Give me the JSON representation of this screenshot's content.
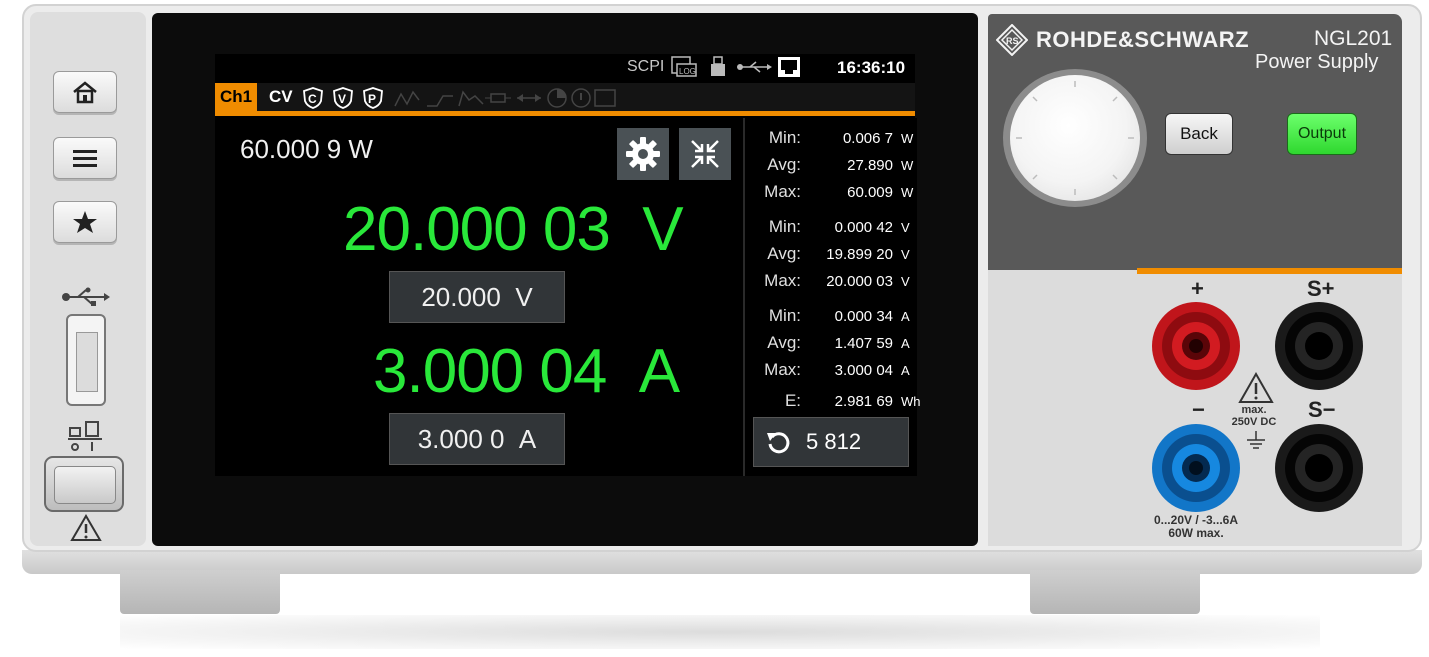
{
  "brand": {
    "name": "ROHDE&SCHWARZ",
    "model": "NGL201",
    "subtitle": "Power Supply"
  },
  "status_bar": {
    "scpi": "SCPI",
    "log_icon": "log-icon",
    "usb_stick_icon": "usb-stick-icon",
    "usb_icon": "usb-icon",
    "lan_icon": "lan-icon",
    "time": "16:36:10"
  },
  "channel_bar": {
    "channel_label": "Ch1",
    "mode": "CV",
    "protections": [
      "C",
      "V",
      "P"
    ],
    "colors": {
      "accent": "#f08c00",
      "value_green": "#29e83a"
    }
  },
  "readings": {
    "power": "60.000 9 W",
    "voltage": {
      "value": "20.000 03",
      "unit": "V",
      "setpoint": "20.000",
      "setpoint_unit": "V"
    },
    "current": {
      "value": "3.000 04",
      "unit": "A",
      "setpoint": "3.000 0",
      "setpoint_unit": "A"
    }
  },
  "stats": {
    "power": [
      {
        "label": "Min:",
        "value": "0.006 7",
        "unit": "W"
      },
      {
        "label": "Avg:",
        "value": "27.890",
        "unit": "W"
      },
      {
        "label": "Max:",
        "value": "60.009",
        "unit": "W"
      }
    ],
    "voltage": [
      {
        "label": "Min:",
        "value": "0.000 42",
        "unit": "V"
      },
      {
        "label": "Avg:",
        "value": "19.899 20",
        "unit": "V"
      },
      {
        "label": "Max:",
        "value": "20.000 03",
        "unit": "V"
      }
    ],
    "current": [
      {
        "label": "Min:",
        "value": "0.000 34",
        "unit": "A"
      },
      {
        "label": "Avg:",
        "value": "1.407 59",
        "unit": "A"
      },
      {
        "label": "Max:",
        "value": "3.000 04",
        "unit": "A"
      }
    ],
    "energy": {
      "label": "E:",
      "value": "2.981 69",
      "unit": "Wh"
    },
    "counter": "5 812"
  },
  "front_panel": {
    "left_buttons": [
      "home-icon",
      "menu-icon",
      "star-icon"
    ],
    "back_label": "Back",
    "output_label": "Output",
    "terminals": {
      "plus": "+",
      "minus": "−",
      "sense_plus": "S+",
      "sense_minus": "S−"
    },
    "warning": [
      "max.",
      "250V DC"
    ],
    "rating": [
      "0...20V / -3...6A",
      "60W max."
    ]
  }
}
